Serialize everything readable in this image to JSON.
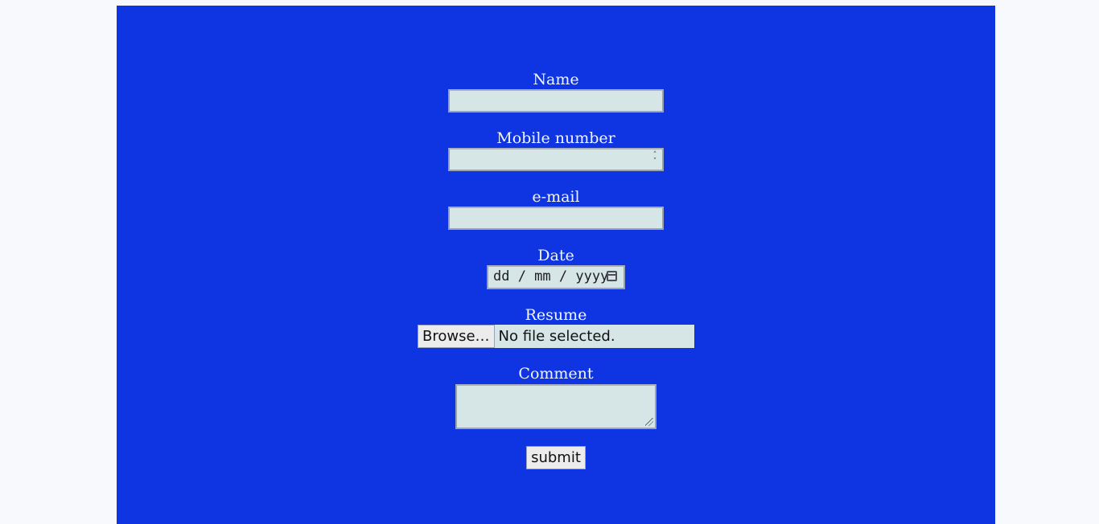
{
  "form": {
    "name": {
      "label": "Name",
      "value": ""
    },
    "mobile": {
      "label": "Mobile number",
      "value": ""
    },
    "email": {
      "label": "e-mail",
      "value": ""
    },
    "date": {
      "label": "Date",
      "placeholder": "dd / mm / yyyy"
    },
    "resume": {
      "label": "Resume",
      "button_label": "Browse…",
      "status": "No file selected."
    },
    "comment": {
      "label": "Comment",
      "value": ""
    },
    "submit_label": "submit"
  },
  "colors": {
    "page_background": "#f8f9fd",
    "panel_background": "#0f35e3",
    "field_background": "#d6e6e6",
    "label_text": "#f2f5f5"
  },
  "icons": {
    "mobile_spinner": "spinner-icon",
    "date_picker": "calendar-icon",
    "textarea_resize": "resize-grip-icon"
  }
}
